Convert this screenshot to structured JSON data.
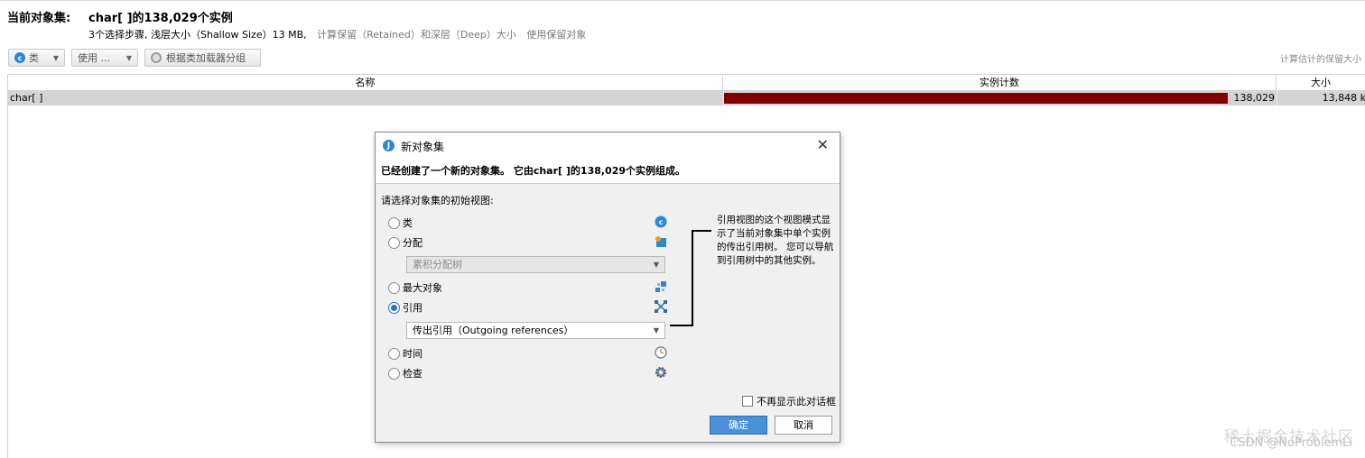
{
  "header": {
    "label": "当前对象集:",
    "value": "char[ ]的138,029个实例",
    "steps": "3个选择步骤, 浅层大小（Shallow Size）13 MB,",
    "link_retained": "计算保留（Retained）和深层（Deep）大小",
    "link_use_retained": "使用保留对象"
  },
  "toolbar": {
    "class_button": "类",
    "use_button": "使用 ...",
    "group_button": "根据类加载器分组",
    "calc_estimate": "计算估计的保留大小"
  },
  "table": {
    "columns": [
      "名称",
      "实例计数",
      "大小"
    ],
    "rows": [
      {
        "name": "char[ ]",
        "count": "138,029",
        "size": "13,848 k",
        "bar_fraction": 1.0
      }
    ]
  },
  "dialog": {
    "title": "新对象集",
    "message": "已经创建了一个新的对象集。 它由char[ ]的138,029个实例组成。",
    "prompt": "请选择对象集的初始视图:",
    "options": [
      {
        "label": "类",
        "checked": false,
        "icon": "class-icon"
      },
      {
        "label": "分配",
        "checked": false,
        "icon": "allocation-icon"
      },
      {
        "label": "最大对象",
        "checked": false,
        "icon": "biggest-objects-icon"
      },
      {
        "label": "引用",
        "checked": true,
        "icon": "references-icon"
      },
      {
        "label": "时间",
        "checked": false,
        "icon": "clock-icon"
      },
      {
        "label": "检查",
        "checked": false,
        "icon": "gear-icon"
      }
    ],
    "alloc_select": "累积分配树",
    "ref_select": "传出引用（Outgoing references）",
    "description": "引用视图的这个视图模式显示了当前对象集中单个实例的传出引用树。 您可以导航到引用树中的其他实例。",
    "dont_show": "不再显示此对话框",
    "ok": "确定",
    "cancel": "取消"
  },
  "watermark": {
    "line1": "稀土掘金技术社区",
    "line2": "CSDN @NoProblemLi"
  },
  "colors": {
    "bar": "#800000",
    "accent": "#2b88d8"
  }
}
